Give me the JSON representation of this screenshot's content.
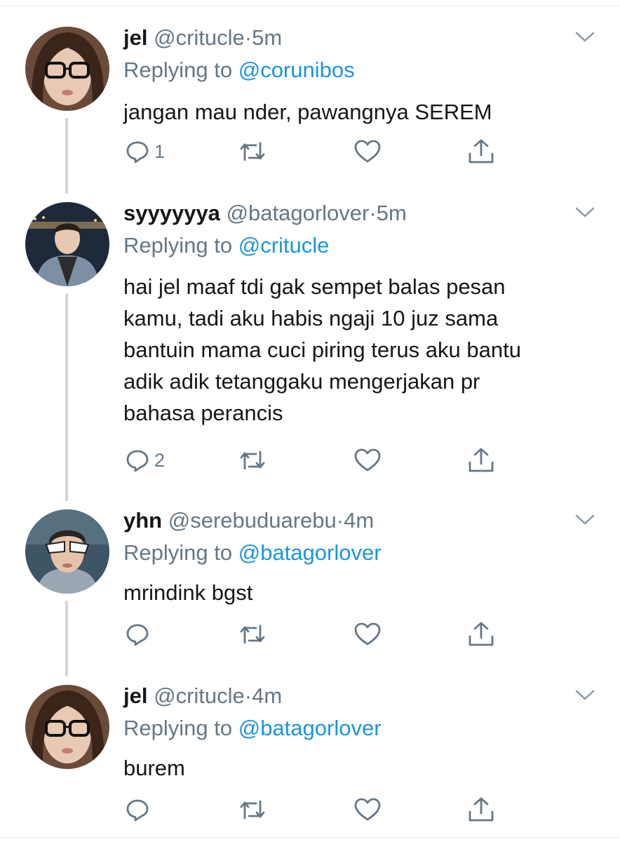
{
  "tweets": [
    {
      "name": "jel",
      "handle": "@critucle",
      "dot": "·",
      "time": "5m",
      "replying_prefix": "Replying to",
      "replying_to": "@corunibos",
      "body_lines": [
        "jangan mau nder, pawangnya SEREM"
      ],
      "reply_count": "1"
    },
    {
      "name": "syyyyyya",
      "handle": "@batagorlover",
      "dot": "·",
      "time": "5m",
      "replying_prefix": "Replying to",
      "replying_to": "@critucle",
      "body_lines": [
        "hai jel maaf tdi gak sempet balas pesan",
        "kamu, tadi aku habis ngaji 10 juz sama",
        "bantuin mama cuci piring terus aku bantu",
        "adik adik tetanggaku mengerjakan pr",
        "bahasa perancis"
      ],
      "reply_count": "2"
    },
    {
      "name": "yhn",
      "handle": "@serebuduarebu",
      "dot": "·",
      "time": "4m",
      "replying_prefix": "Replying to",
      "replying_to": "@batagorlover",
      "body_lines": [
        "mrindink bgst"
      ],
      "reply_count": ""
    },
    {
      "name": "jel",
      "handle": "@critucle",
      "dot": "·",
      "time": "4m",
      "replying_prefix": "Replying to",
      "replying_to": "@batagorlover",
      "body_lines": [
        "burem"
      ],
      "reply_count": ""
    }
  ],
  "icons": {
    "reply": "reply-icon",
    "retweet": "retweet-icon",
    "like": "heart-icon",
    "share": "share-icon",
    "more": "chevron-down-icon"
  },
  "colors": {
    "link": "#1b95e0",
    "secondary": "#657786",
    "text": "#14171a",
    "thread_line": "#ccd6dd"
  }
}
